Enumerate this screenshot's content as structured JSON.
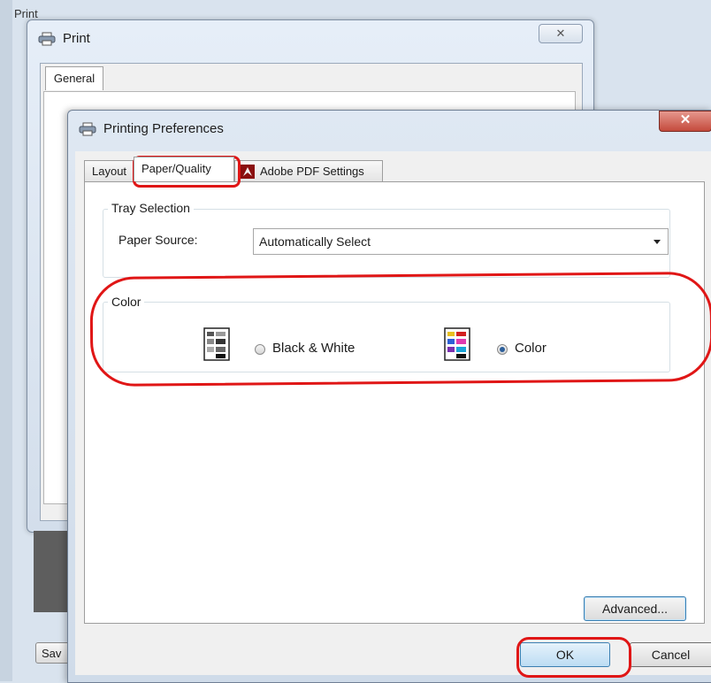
{
  "background_window": {
    "partial_title": "Print",
    "title": "Print",
    "close_glyph": "✕",
    "tab_general": "General",
    "save_partial": "Sav"
  },
  "dialog": {
    "title": "Printing Preferences",
    "close_glyph": "✕",
    "tabs": [
      {
        "label": "Layout",
        "selected": false
      },
      {
        "label": "Paper/Quality",
        "selected": true
      },
      {
        "label": "Adobe PDF Settings",
        "selected": false
      }
    ],
    "tray_selection": {
      "group_label": "Tray Selection",
      "paper_source_label": "Paper Source:",
      "paper_source_value": "Automatically Select"
    },
    "color_group": {
      "group_label": "Color",
      "options": [
        {
          "label": "Black & White",
          "checked": false,
          "icon": "bw-document-icon"
        },
        {
          "label": "Color",
          "checked": true,
          "icon": "color-document-icon"
        }
      ]
    },
    "buttons": {
      "advanced": "Advanced...",
      "ok": "OK",
      "cancel": "Cancel"
    }
  },
  "colors": {
    "annotation": "#e01616",
    "accent": "#3c7fb1",
    "close_button": "#c44a3c"
  }
}
